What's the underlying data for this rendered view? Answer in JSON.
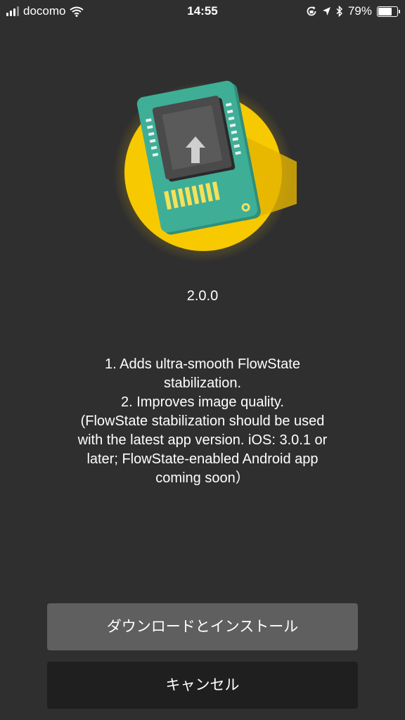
{
  "status_bar": {
    "carrier": "docomo",
    "time": "14:55",
    "battery_percent": "79%",
    "battery_level": 0.79
  },
  "firmware": {
    "version": "2.0.0",
    "notes": [
      "1. Adds ultra-smooth FlowState",
      "stabilization.",
      "2. Improves image quality.",
      "(FlowState stabilization should be used",
      "with the latest app version. iOS: 3.0.1 or",
      "later; FlowState-enabled Android app",
      "coming soon）"
    ]
  },
  "buttons": {
    "download_install": "ダウンロードとインストール",
    "cancel": "キャンセル"
  },
  "colors": {
    "background": "#2f2f30",
    "circle": "#f7c900",
    "board": "#3fae96",
    "primary_button": "#5f5f60",
    "secondary_button": "#1f1f20"
  },
  "icons": [
    "signal-icon",
    "wifi-icon",
    "screen-lock-icon",
    "location-icon",
    "bluetooth-icon",
    "battery-icon",
    "firmware-chip-icon",
    "upload-arrow-icon"
  ]
}
